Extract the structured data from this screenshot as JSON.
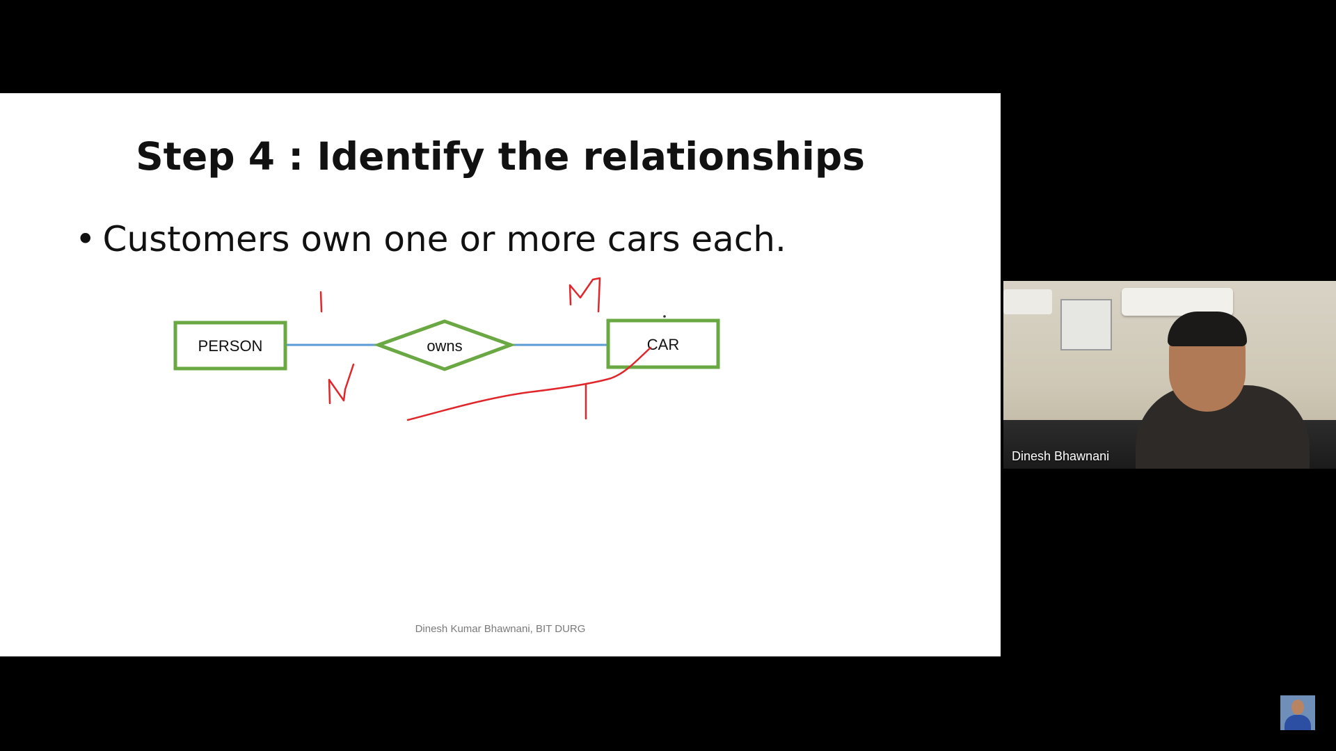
{
  "slide": {
    "title": "Step 4 : Identify the relationships",
    "bullet_marker": "•",
    "bullet_text": "Customers own one or more cars each.",
    "footer": "Dinesh Kumar Bhawnani, BIT DURG",
    "er_diagram": {
      "entity_left": "PERSON",
      "relationship": "owns",
      "entity_right": "CAR",
      "entity_border_color": "#6aa843",
      "connector_color": "#5b9bd5"
    },
    "annotations": {
      "ink_color": "#e0262a",
      "cardinality_left_1": "1",
      "cardinality_right": "M",
      "cardinality_left_2": "N"
    }
  },
  "participant": {
    "name": "Dinesh Bhawnani"
  },
  "self_view": {
    "icon": "participant-avatar-icon"
  }
}
